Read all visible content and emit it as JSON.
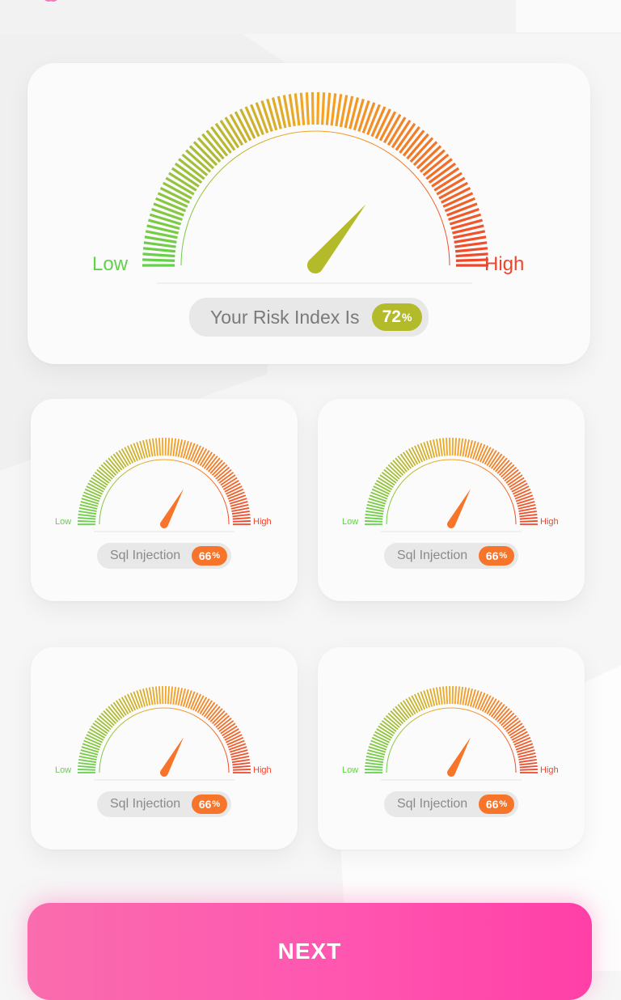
{
  "main_gauge": {
    "low_label": "Low",
    "high_label": "High",
    "caption": "Your Risk Index Is",
    "value": "72",
    "unit": "%",
    "value_fraction": 0.72,
    "needle_color": "#b4bb2a"
  },
  "small_gauges": [
    {
      "low_label": "Low",
      "high_label": "High",
      "caption": "Sql Injection",
      "value": "66",
      "unit": "%",
      "value_fraction": 0.66,
      "needle_color": "#f7752a"
    },
    {
      "low_label": "Low",
      "high_label": "High",
      "caption": "Sql Injection",
      "value": "66",
      "unit": "%",
      "value_fraction": 0.66,
      "needle_color": "#f7752a"
    },
    {
      "low_label": "Low",
      "high_label": "High",
      "caption": "Sql Injection",
      "value": "66",
      "unit": "%",
      "value_fraction": 0.66,
      "needle_color": "#f7752a"
    },
    {
      "low_label": "Low",
      "high_label": "High",
      "caption": "Sql Injection",
      "value": "66",
      "unit": "%",
      "value_fraction": 0.66,
      "needle_color": "#f7752a"
    }
  ],
  "next_button": {
    "label": "NEXT"
  },
  "colors": {
    "low": "#63d14a",
    "mid": "#f4a623",
    "high": "#f0452b",
    "button": "#ff56b0"
  },
  "icons": {
    "top_logo": "heart-logo-icon"
  }
}
